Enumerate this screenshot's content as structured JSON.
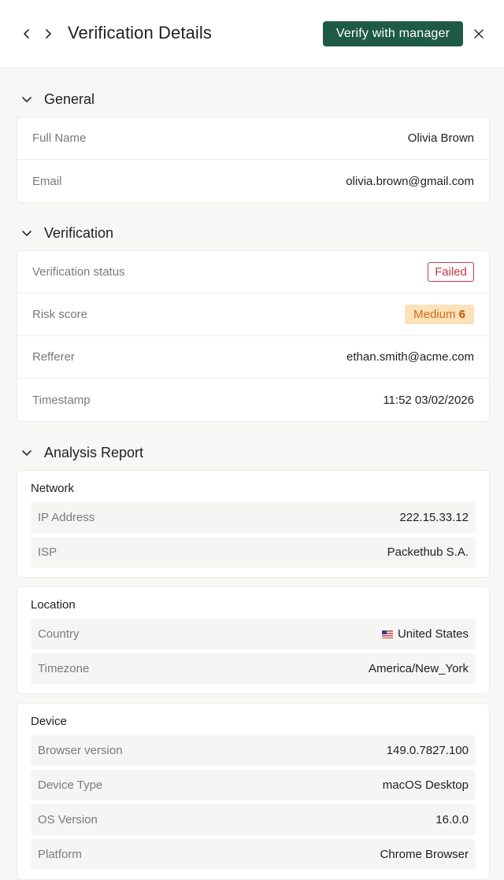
{
  "header": {
    "title": "Verification Details",
    "verify_label": "Verify with manager"
  },
  "general": {
    "title": "General",
    "rows": [
      {
        "label": "Full Name",
        "value": "Olivia Brown"
      },
      {
        "label": "Email",
        "value": "olivia.brown@gmail.com"
      }
    ]
  },
  "verification": {
    "title": "Verification",
    "status_label": "Verification status",
    "status_value": "Failed",
    "risk_label": "Risk score",
    "risk_level": "Medium",
    "risk_score": "6",
    "referrer_label": "Refferer",
    "referrer_value": "ethan.smith@acme.com",
    "timestamp_label": "Timestamp",
    "timestamp_value": "11:52 03/02/2026"
  },
  "analysis": {
    "title": "Analysis Report",
    "network": {
      "title": "Network",
      "rows": [
        {
          "label": "IP Address",
          "value": "222.15.33.12"
        },
        {
          "label": "ISP",
          "value": "Packethub S.A."
        }
      ]
    },
    "location": {
      "title": "Location",
      "rows": [
        {
          "label": "Country",
          "value": "United States"
        },
        {
          "label": "Timezone",
          "value": "America/New_York"
        }
      ]
    },
    "device": {
      "title": "Device",
      "rows": [
        {
          "label": "Browser version",
          "value": "149.0.7827.100"
        },
        {
          "label": "Device Type",
          "value": "macOS Desktop"
        },
        {
          "label": "OS Version",
          "value": "16.0.0"
        },
        {
          "label": "Platform",
          "value": "Chrome Browser"
        }
      ]
    }
  },
  "colors": {
    "primary_button": "#1f5a45",
    "failed": "#c9374a",
    "medium_bg": "#fce2b8",
    "medium_text": "#d46a1e"
  },
  "icons": {
    "back": "chevron-left-icon",
    "forward": "chevron-right-icon",
    "close": "close-icon",
    "collapse": "chevron-down-icon",
    "flag": "us-flag-icon"
  }
}
